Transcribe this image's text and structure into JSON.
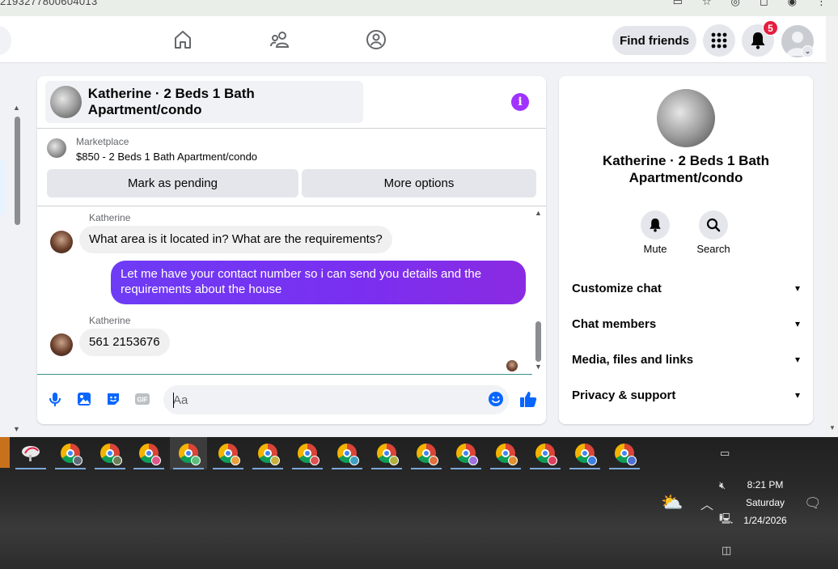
{
  "browser": {
    "url_fragment": "2193277800604013"
  },
  "topnav": {
    "find_friends": "Find friends",
    "notification_count": "5",
    "icons": [
      "home-icon",
      "friends-icon",
      "groups-icon",
      "menu-grid-icon",
      "bell-icon"
    ]
  },
  "chat": {
    "title": "Katherine · 2 Beds 1 Bath Apartment/condo",
    "marketplace_label": "Marketplace",
    "listing": "$850 - 2 Beds 1 Bath Apartment/condo",
    "mark_pending": "Mark as pending",
    "more_options": "More options",
    "messages": [
      {
        "sender": "Katherine",
        "text": "What area is it located in? What are the requirements?",
        "direction": "in"
      },
      {
        "text": "Let me have your contact number so i can send you details and the requirements about the house",
        "direction": "out"
      },
      {
        "sender": "Katherine",
        "text": "561 2153676",
        "direction": "in"
      }
    ],
    "composer_placeholder": "Aa",
    "gif_label": "GIF"
  },
  "details": {
    "title": "Katherine · 2 Beds 1 Bath Apartment/condo",
    "mute": "Mute",
    "search": "Search",
    "rows": [
      "Customize chat",
      "Chat members",
      "Media, files and links",
      "Privacy & support"
    ]
  },
  "taskbar": {
    "time": "8:21 PM",
    "day": "Saturday",
    "date": "1/24/2026"
  },
  "colors": {
    "outgoing_bubble": "#7a2ff0",
    "info_icon": "#a033ff",
    "like_icon": "#0866ff",
    "badge": "#e41e3f"
  }
}
